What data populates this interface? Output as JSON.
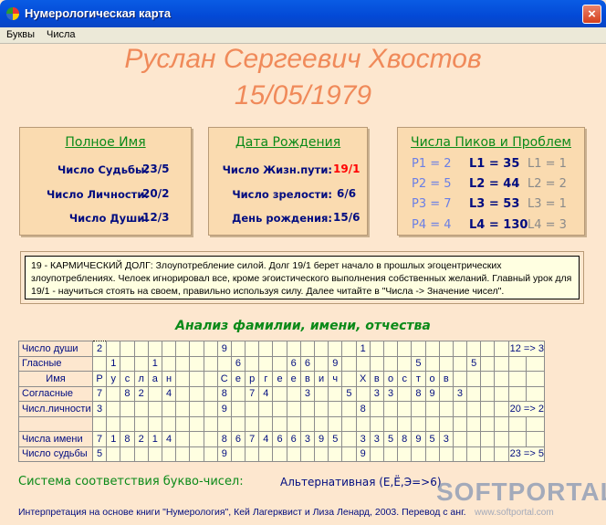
{
  "window": {
    "title": "Нумерологическая карта",
    "close_glyph": "×",
    "icon": "app-logo-icon"
  },
  "menu": {
    "items": [
      "Буквы",
      "Числа"
    ]
  },
  "person": {
    "name": "Руслан Сергеевич Хвостов",
    "date": "15/05/1979"
  },
  "full_name_panel": {
    "heading": "Полное Имя",
    "rows": [
      {
        "label": "Число Судьбы:",
        "value": "23/5"
      },
      {
        "label": "Число Личности:",
        "value": "20/2"
      },
      {
        "label": "Число Души:",
        "value": "12/3"
      }
    ]
  },
  "birth_panel": {
    "heading": "Дата Рождения",
    "rows": [
      {
        "label": "Число Жизн.пути:",
        "value": "19/1",
        "highlight": "#ff0000"
      },
      {
        "label": "Число зрелости:",
        "value": "6/6"
      },
      {
        "label": "День рождения:",
        "value": "15/6"
      }
    ]
  },
  "peaks_panel": {
    "heading": "Числа Пиков и Проблем",
    "rows": [
      {
        "p": "P1 =  2",
        "l": "L1 =  35",
        "ll": "L1 =  1"
      },
      {
        "p": "P2 =  5",
        "l": "L2 =  44",
        "ll": "L2 =  2"
      },
      {
        "p": "P3 =  7",
        "l": "L3 =  53",
        "ll": "L3 =  1"
      },
      {
        "p": "P4 =  4",
        "l": "L4 = 130",
        "ll": "L4 =  3"
      }
    ]
  },
  "note": "19 - КАРМИЧЕСКИЙ ДОЛГ: Злоупотребление силой. Долг 19/1 берет начало в прошлых эгоцентрических злоупотреблениях. Челоек игнорировал все, кроме эгоистического выполнения собственных желаний. Главный урок для 19/1 - научиться стоять на своем, правильно используя силу. Далее читайте в \"Числа -> Значение чисел\".",
  "analysis": {
    "title": "Анализ фамилии, имени, отчества",
    "rows": [
      {
        "label": "Число души",
        "cells": [
          "2",
          "",
          "",
          "",
          "",
          "",
          "",
          "",
          "",
          "9",
          "",
          "",
          "",
          "",
          "",
          "",
          "",
          "",
          "",
          "1",
          "",
          "",
          "",
          "",
          "",
          "",
          "",
          "",
          "",
          "",
          "",
          "",
          "12 => 3"
        ]
      },
      {
        "label": "Гласные",
        "cells": [
          "",
          "1",
          "",
          "",
          "1",
          "",
          "",
          "",
          "",
          "",
          "6",
          "",
          "",
          "",
          "6",
          "6",
          "",
          "9",
          "",
          "",
          "",
          "",
          "",
          "5",
          "",
          "",
          "",
          "5",
          "",
          "",
          "",
          "",
          ""
        ]
      },
      {
        "label": "Имя",
        "center": true,
        "cells": [
          "Р",
          "у",
          "с",
          "л",
          "а",
          "н",
          "",
          "",
          "",
          "С",
          "е",
          "р",
          "г",
          "е",
          "е",
          "в",
          "и",
          "ч",
          "",
          "Х",
          "в",
          "о",
          "с",
          "т",
          "о",
          "в",
          "",
          "",
          "",
          "",
          "",
          "",
          ""
        ]
      },
      {
        "label": "Согласные",
        "cells": [
          "7",
          "",
          "8",
          "2",
          "",
          "4",
          "",
          "",
          "",
          "8",
          "",
          "7",
          "4",
          "",
          "",
          "3",
          "",
          "",
          "5",
          "",
          "3",
          "3",
          "",
          "8",
          "9",
          "",
          "3",
          "",
          "",
          "",
          "",
          "",
          ""
        ]
      },
      {
        "label": "Числ.личности",
        "cells": [
          "3",
          "",
          "",
          "",
          "",
          "",
          "",
          "",
          "",
          "9",
          "",
          "",
          "",
          "",
          "",
          "",
          "",
          "",
          "",
          "8",
          "",
          "",
          "",
          "",
          "",
          "",
          "",
          "",
          "",
          "",
          "",
          "",
          "20 => 2"
        ]
      },
      {
        "label": "",
        "cells": [
          "",
          "",
          "",
          "",
          "",
          "",
          "",
          "",
          "",
          "",
          "",
          "",
          "",
          "",
          "",
          "",
          "",
          "",
          "",
          "",
          "",
          "",
          "",
          "",
          "",
          "",
          "",
          "",
          "",
          "",
          "",
          "",
          ""
        ]
      },
      {
        "label": "Числа имени",
        "cells": [
          "7",
          "1",
          "8",
          "2",
          "1",
          "4",
          "",
          "",
          "",
          "8",
          "6",
          "7",
          "4",
          "6",
          "6",
          "3",
          "9",
          "5",
          "",
          "3",
          "3",
          "5",
          "8",
          "9",
          "5",
          "3",
          "",
          "",
          "",
          "",
          "",
          "",
          ""
        ]
      },
      {
        "label": "Число судьбы",
        "cells": [
          "5",
          "",
          "",
          "",
          "",
          "",
          "",
          "",
          "",
          "9",
          "",
          "",
          "",
          "",
          "",
          "",
          "",
          "",
          "",
          "9",
          "",
          "",
          "",
          "",
          "",
          "",
          "",
          "",
          "",
          "",
          "",
          "",
          "23 => 5"
        ]
      }
    ]
  },
  "system": {
    "label": "Система соответствия букво-чисел:",
    "value": "Альтернативная (Е,Ё,Э=>6)"
  },
  "footer": "Интерпретация на основе книги \"Нумерология\", Кей Лагерквист и Лиза Ленард, 2003. Перевод с анг.",
  "watermark": {
    "brand": "SOFTPORTAL",
    "url": "www.softportal.com"
  }
}
